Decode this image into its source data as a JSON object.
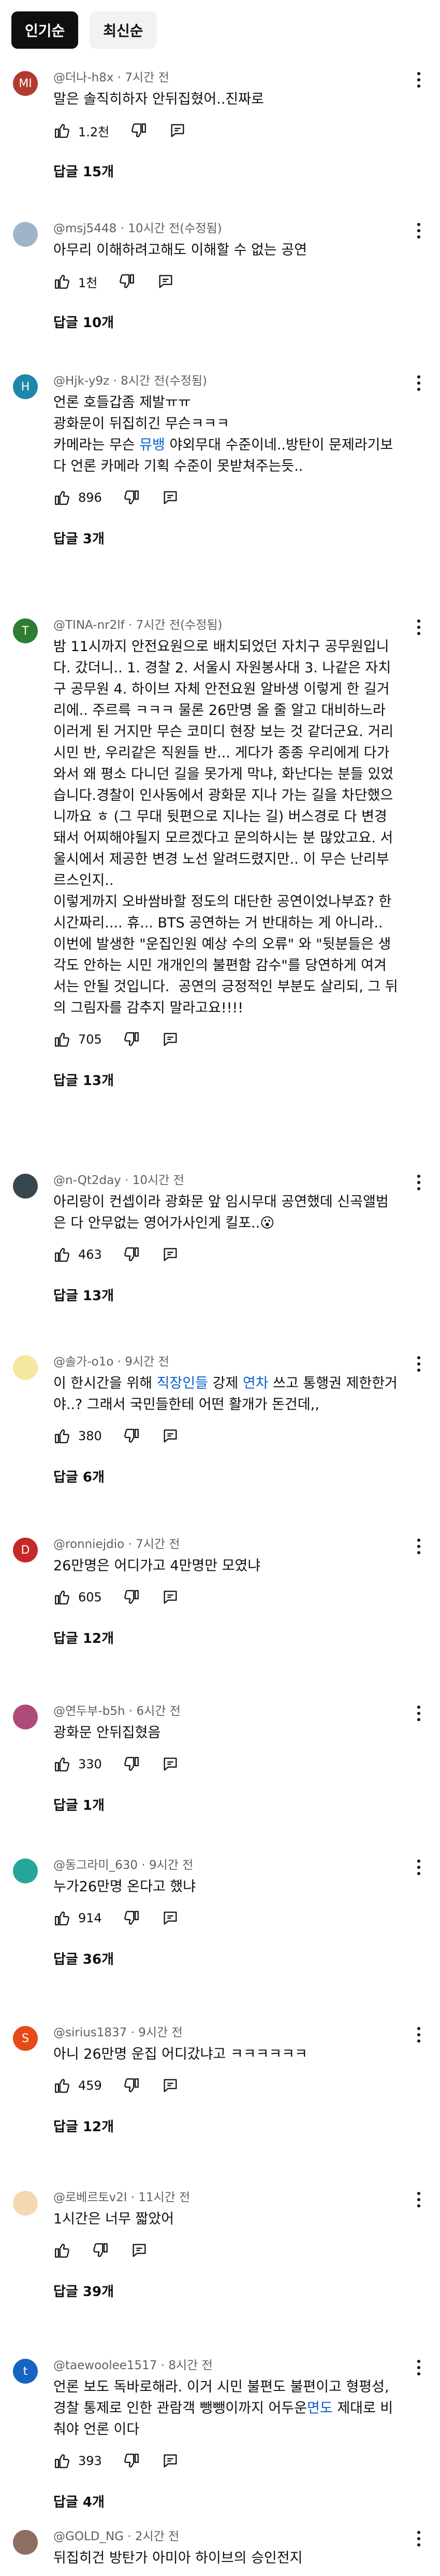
{
  "chips": [
    {
      "label": "인기순",
      "active": true
    },
    {
      "label": "최신순",
      "active": false
    }
  ],
  "comments": [
    {
      "author": "@더나-h8x · 7시간 전",
      "avatar_text": "MI",
      "avatar_color": "#b23a2e",
      "text": [
        {
          "t": "말은 솔직히하자 안뒤집혔어..진짜로"
        }
      ],
      "likes": "1.2천",
      "replies": "답글 15개"
    },
    {
      "author": "@msj5448 · 10시간 전(수정됨)",
      "avatar_text": "",
      "avatar_color": "#9fb4c8",
      "text": [
        {
          "t": "아무리 이해하려고해도 이해할 수 없는 공연"
        }
      ],
      "likes": "1천",
      "replies": "답글 10개"
    },
    {
      "author": "@Hjk-y9z · 8시간 전(수정됨)",
      "avatar_text": "H",
      "avatar_color": "#1e88a8",
      "text": [
        {
          "t": "언론 호들갑좀 제발ㅠㅠ\n광화문이 뒤집히긴 무슨ㅋㅋㅋ\n카메라는 무슨 "
        },
        {
          "t": "뮤뱅",
          "link": true
        },
        {
          "t": " 야외무대 수준이네..방탄이 문제라기보다 언론 카메라 기획 수준이 못받쳐주는듯.."
        }
      ],
      "likes": "896",
      "replies": "답글 3개"
    },
    {
      "author": "@TINA-nr2lf · 7시간 전(수정됨)",
      "avatar_text": "T",
      "avatar_color": "#2e7d32",
      "text": [
        {
          "t": "밤 11시까지 안전요원으로 배치되었던 자치구 공무원입니다. 갔더니.. 1. 경찰 2. 서울시 자원봉사대 3. 나같은 자치구 공무원 4. 하이브 자체 안전요원 알바생 이렇게 한 길거리에.. 주르륵 ㅋㅋㅋ 물론 26만명 올 줄 알고 대비하느라 이러게 된 거지만 무슨 코미디 현장 보는 것 같더군요. 거리 시민 반, 우리같은 직원들 반... 게다가 종종 우리에게 다가와서 왜 평소 다니던 길을 못가게 막냐, 화난다는 분들 있었습니다.경찰이 인사동에서 광화문 지나 가는 길을 차단했으니까요 ㅎ (그 무대 뒷편으로 지나는 길) 버스경로 다 변경돼서 어찌해야될지 모르겠다고 문의하시는 분 많았고요. 서울시에서 제공한 변경 노선 알려드렸지만.. 이 무슨 난리부르스인지..\n이렇게까지 오바쌈바할 정도의 대단한 공연이었나부죠? 한 시간짜리.... 휴... BTS 공연하는 거 반대하는 게 아니라..\n이번에 발생한 \"운집인원 예상 수의 오류\" 와 \"뒷분들은 생각도 안하는 시민 개개인의 불편함 감수\"를 당연하게 여겨서는 안될 것입니다.  공연의 긍정적인 부분도 살리되, 그 뒤의 그림자를 감추지 말라고요!!!!"
        }
      ],
      "likes": "705",
      "replies": "답글 13개"
    },
    {
      "author": "@n-Qt2day · 10시간 전",
      "avatar_text": "",
      "avatar_color": "#37474f",
      "text": [
        {
          "t": "아리랑이 컨셉이라 광화문 앞 임시무대 공연했데 신곡앨범은 다 안무없는 영어가사인게 킬포.."
        },
        {
          "t": "😮",
          "emoji": true
        }
      ],
      "likes": "463",
      "replies": "답글 13개"
    },
    {
      "author": "@솔가-o1o · 9시간 전",
      "avatar_text": "",
      "avatar_color": "#f6e7a0",
      "text": [
        {
          "t": "이 한시간을 위해 "
        },
        {
          "t": "직장인들",
          "link": true
        },
        {
          "t": " 강제 "
        },
        {
          "t": "연차",
          "link": true
        },
        {
          "t": " 쓰고 통행권 제한한거야..? 그래서 국민들한테 어떤 활개가 돈건데,,"
        }
      ],
      "likes": "380",
      "replies": "답글 6개"
    },
    {
      "author": "@ronniejdio · 7시간 전",
      "avatar_text": "D",
      "avatar_color": "#c62828",
      "text": [
        {
          "t": "26만명은 어디가고 4만명만 모였냐"
        }
      ],
      "likes": "605",
      "replies": "답글 12개"
    },
    {
      "author": "@연두부-b5h · 6시간 전",
      "avatar_text": "",
      "avatar_color": "#b04a7a",
      "text": [
        {
          "t": "광화문 안뒤집혔음"
        }
      ],
      "likes": "330",
      "replies": "답글 1개"
    },
    {
      "author": "@동그라미_630 · 9시간 전",
      "avatar_text": "",
      "avatar_color": "#26a69a",
      "text": [
        {
          "t": "누가26만명 온다고 했냐"
        }
      ],
      "likes": "914",
      "replies": "답글 36개"
    },
    {
      "author": "@sirius1837 · 9시간 전",
      "avatar_text": "S",
      "avatar_color": "#e64a19",
      "text": [
        {
          "t": "아니 26만명 운집 어디갔냐고 ㅋㅋㅋㅋㅋㅋ"
        }
      ],
      "likes": "459",
      "replies": "답글 12개"
    },
    {
      "author": "@로베르토v2l · 11시간 전",
      "avatar_text": "",
      "avatar_color": "#f3d9b1",
      "text": [
        {
          "t": "1시간은 너무 짧았어"
        }
      ],
      "likes": "",
      "replies": "답글 39개"
    },
    {
      "author": "@taewoolee1517 · 8시간 전",
      "avatar_text": "t",
      "avatar_color": "#1565c0",
      "text": [
        {
          "t": "언론 보도 독바로해라. 이거 시민 불편도 불편이고 형평성, 경찰 통제로 인한 관람객 뺑뺑이까지 어두운"
        },
        {
          "t": "면도",
          "link": true
        },
        {
          "t": " 제대로 비춰야 언론 이다"
        }
      ],
      "likes": "393",
      "replies": "답글 4개"
    },
    {
      "author": "@GOLD_NG · 2시간 전",
      "avatar_text": "",
      "avatar_color": "#8d6e63",
      "text": [
        {
          "t": "뒤집히건 방탄가 아미아 하이브의 승인전지"
        }
      ],
      "likes": "",
      "replies": ""
    }
  ]
}
